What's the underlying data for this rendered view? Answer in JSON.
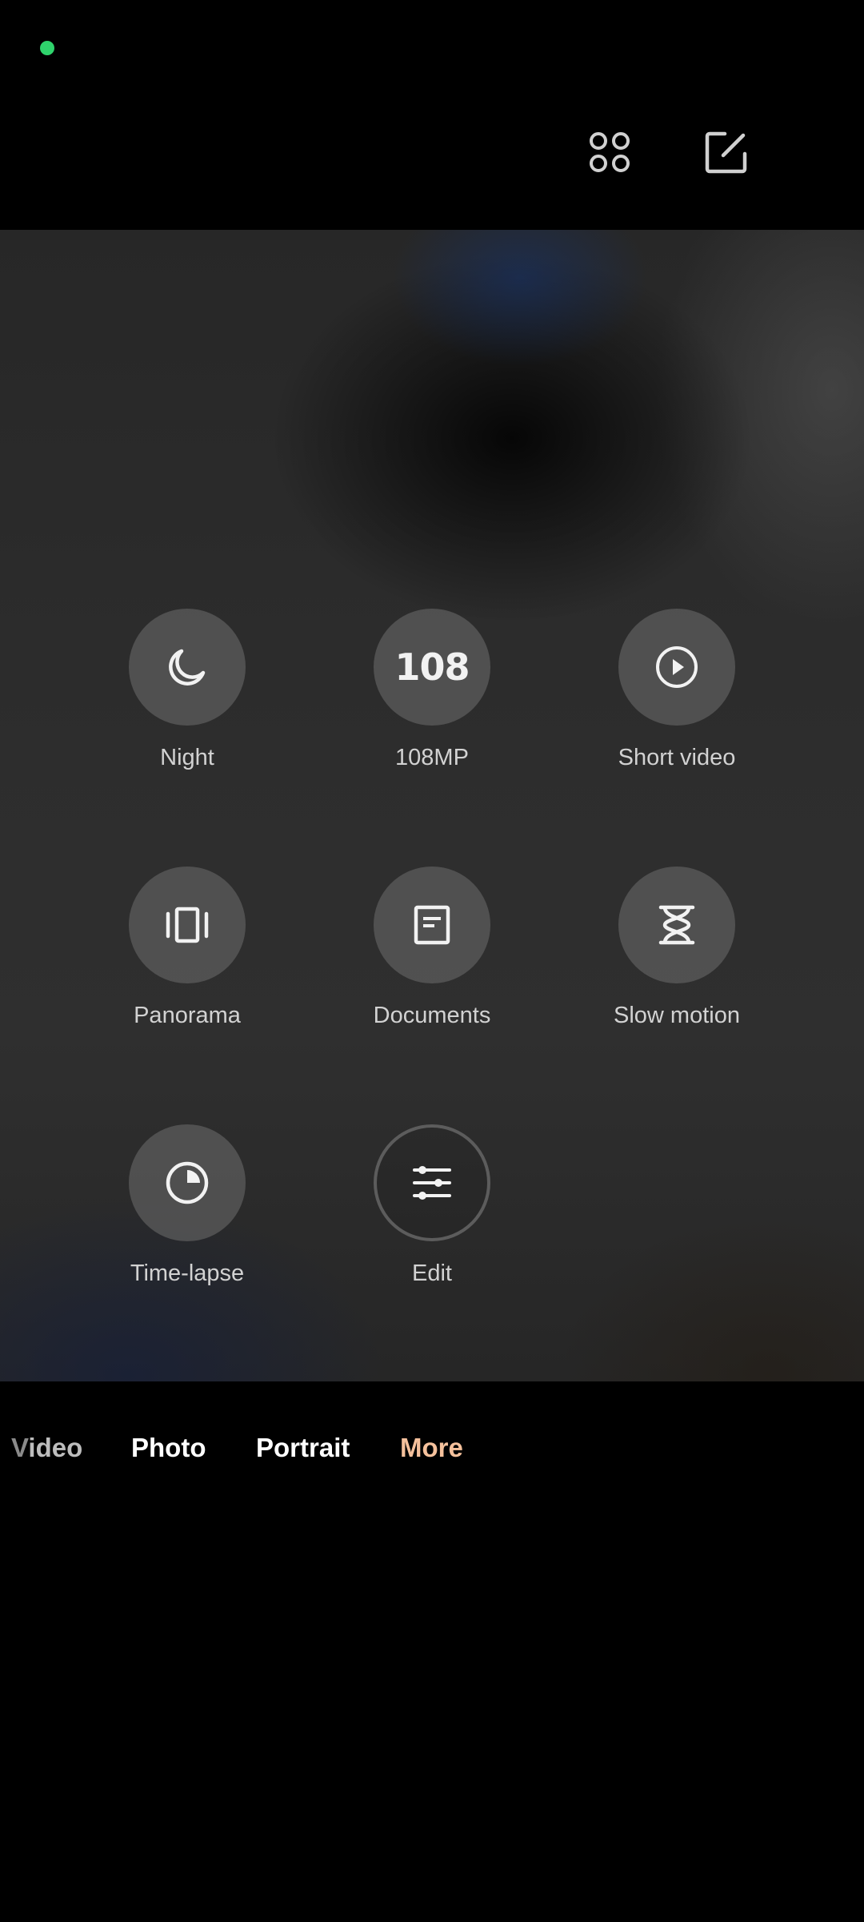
{
  "status": {
    "indicator_color": "#2fd36c"
  },
  "header": {
    "grid_icon": "grid-four-circles-icon",
    "edit_icon": "edit-square-icon"
  },
  "modes": [
    {
      "label": "Night",
      "icon": "moon-icon"
    },
    {
      "label": "108MP",
      "icon_text": "108"
    },
    {
      "label": "Short video",
      "icon": "play-circle-icon"
    },
    {
      "label": "Panorama",
      "icon": "panorama-icon"
    },
    {
      "label": "Documents",
      "icon": "document-icon"
    },
    {
      "label": "Slow motion",
      "icon": "hourglass-icon"
    },
    {
      "label": "Time-lapse",
      "icon": "timer-clock-icon"
    },
    {
      "label": "Edit",
      "icon": "sliders-icon"
    }
  ],
  "tabs": {
    "video_fade": "V",
    "video_rest": "ideo",
    "photo": "Photo",
    "portrait": "Portrait",
    "more": "More",
    "active_color": "#f5c19c"
  }
}
